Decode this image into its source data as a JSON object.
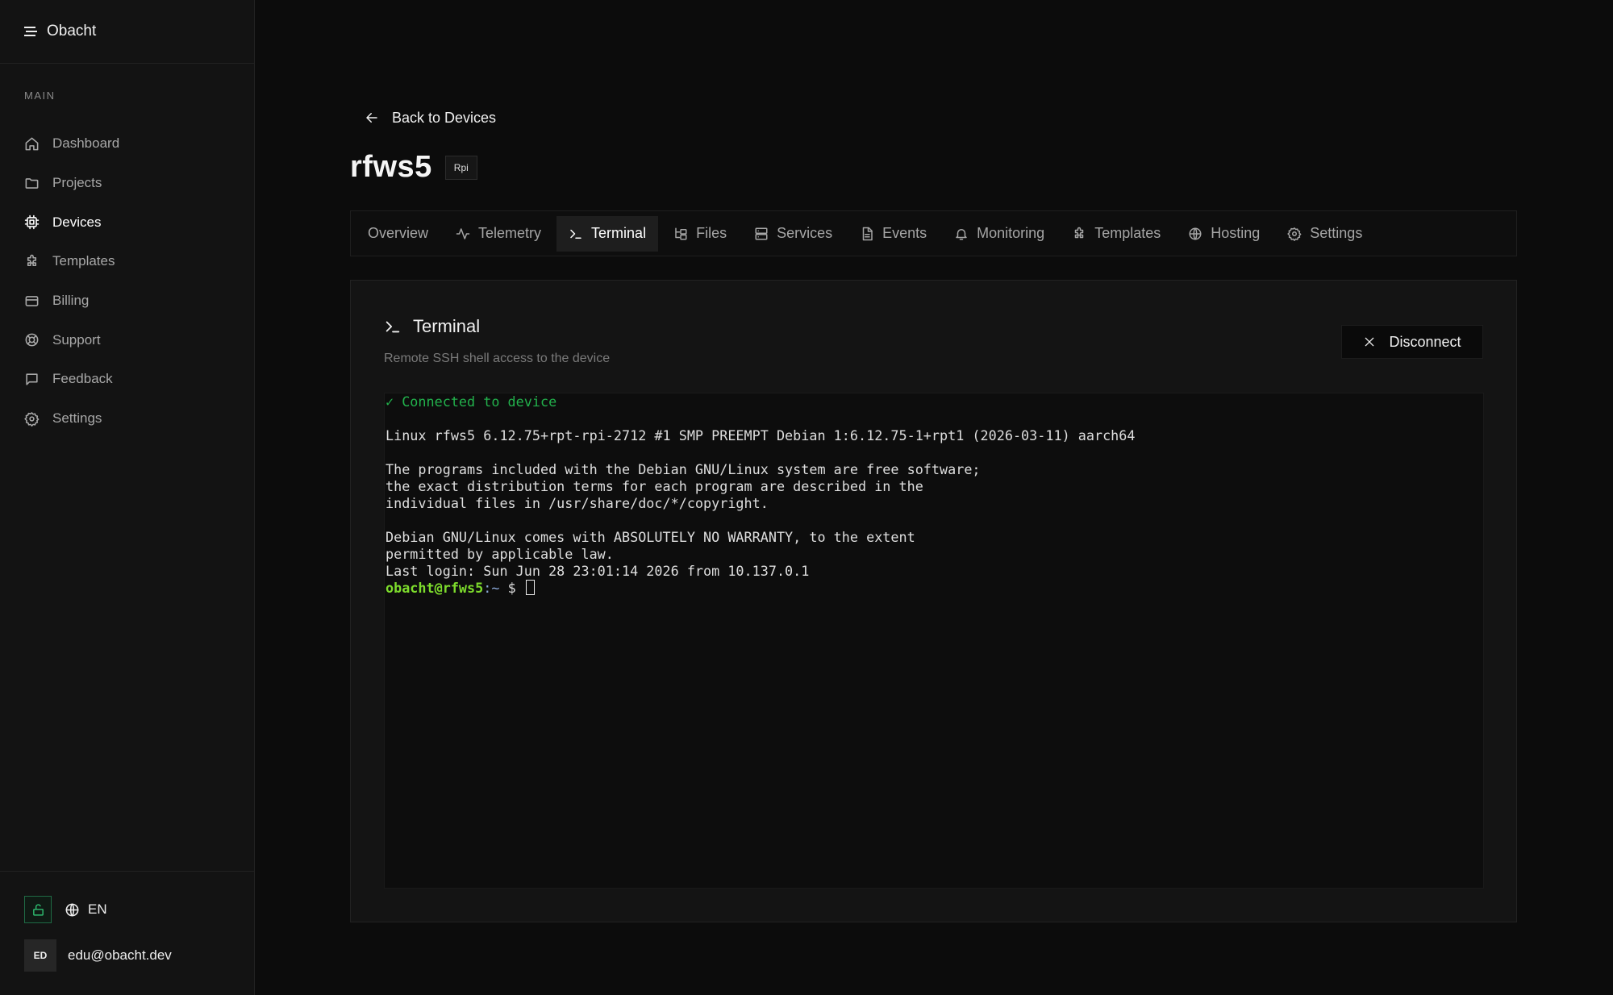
{
  "app": {
    "name": "Obacht"
  },
  "sidebar": {
    "section_label": "MAIN",
    "items": [
      {
        "label": "Dashboard",
        "icon": "home-icon"
      },
      {
        "label": "Projects",
        "icon": "folder-icon"
      },
      {
        "label": "Devices",
        "icon": "chip-icon",
        "active": true
      },
      {
        "label": "Templates",
        "icon": "puzzle-icon"
      },
      {
        "label": "Billing",
        "icon": "credit-card-icon"
      },
      {
        "label": "Support",
        "icon": "lifebuoy-icon"
      },
      {
        "label": "Feedback",
        "icon": "message-square-icon"
      },
      {
        "label": "Settings",
        "icon": "gear-icon"
      }
    ],
    "language": "EN",
    "user": {
      "initials": "ED",
      "email": "edu@obacht.dev"
    }
  },
  "header": {
    "back_label": "Back to Devices",
    "device_name": "rfws5",
    "device_badge": "Rpi"
  },
  "tabs": [
    {
      "label": "Overview",
      "icon": ""
    },
    {
      "label": "Telemetry",
      "icon": "activity-icon"
    },
    {
      "label": "Terminal",
      "icon": "terminal-icon",
      "active": true
    },
    {
      "label": "Files",
      "icon": "folder-tree-icon"
    },
    {
      "label": "Services",
      "icon": "server-icon"
    },
    {
      "label": "Events",
      "icon": "file-text-icon"
    },
    {
      "label": "Monitoring",
      "icon": "bell-icon"
    },
    {
      "label": "Templates",
      "icon": "puzzle-icon"
    },
    {
      "label": "Hosting",
      "icon": "globe-icon"
    },
    {
      "label": "Settings",
      "icon": "gear-icon"
    }
  ],
  "terminal_panel": {
    "title": "Terminal",
    "description": "Remote SSH shell access to the device",
    "disconnect_label": "Disconnect",
    "status_line": "✓ Connected to device",
    "output_lines": [
      "",
      "Linux rfws5 6.12.75+rpt-rpi-2712 #1 SMP PREEMPT Debian 1:6.12.75-1+rpt1 (2026-03-11) aarch64",
      "",
      "The programs included with the Debian GNU/Linux system are free software;",
      "the exact distribution terms for each program are described in the",
      "individual files in /usr/share/doc/*/copyright.",
      "",
      "Debian GNU/Linux comes with ABSOLUTELY NO WARRANTY, to the extent",
      "permitted by applicable law.",
      "Last login: Sun Jun 28 23:01:14 2026 from 10.137.0.1"
    ],
    "prompt": {
      "user_host": "obacht@rfws5",
      "path": ":~",
      "symbol": " $ "
    }
  },
  "colors": {
    "accent_green": "#22b14c",
    "prompt_green": "#7ddc2c",
    "background": "#0c0c0c"
  }
}
